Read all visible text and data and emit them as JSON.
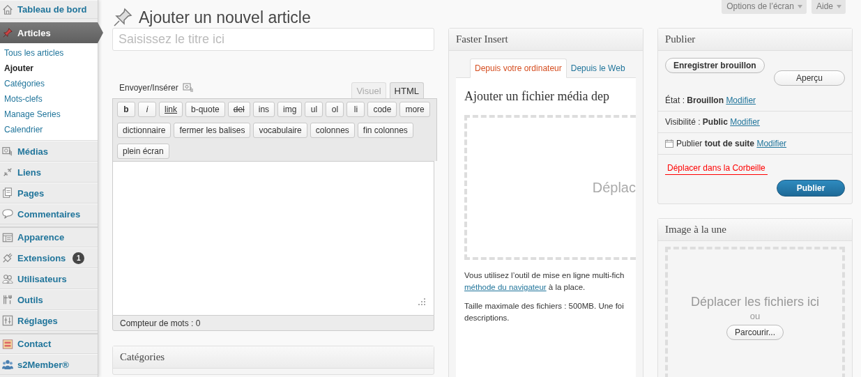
{
  "sidebar": {
    "items": [
      {
        "label": "Tableau de bord",
        "selected": false,
        "separator_before": false
      },
      {
        "label": "Articles",
        "selected": true,
        "separator_before": false,
        "children": [
          {
            "label": "Tous les articles",
            "selected": false
          },
          {
            "label": "Ajouter",
            "selected": true
          },
          {
            "label": "Catégories",
            "selected": false
          },
          {
            "label": "Mots-clefs",
            "selected": false
          },
          {
            "label": "Manage Series",
            "selected": false
          },
          {
            "label": "Calendrier",
            "selected": false
          }
        ]
      },
      {
        "label": "Médias",
        "selected": false,
        "separator_before": false
      },
      {
        "label": "Liens",
        "selected": false,
        "separator_before": false
      },
      {
        "label": "Pages",
        "selected": false,
        "separator_before": false
      },
      {
        "label": "Commentaires",
        "selected": false,
        "separator_before": false
      },
      {
        "label": "Apparence",
        "selected": false,
        "separator_before": true
      },
      {
        "label": "Extensions",
        "selected": false,
        "separator_before": false,
        "badge": "1"
      },
      {
        "label": "Utilisateurs",
        "selected": false,
        "separator_before": false
      },
      {
        "label": "Outils",
        "selected": false,
        "separator_before": false
      },
      {
        "label": "Réglages",
        "selected": false,
        "separator_before": false
      },
      {
        "label": "Contact",
        "selected": false,
        "separator_before": true
      },
      {
        "label": "s2Member®",
        "selected": false,
        "separator_before": false
      }
    ]
  },
  "header": {
    "title": "Ajouter un nouvel article",
    "screen_buttons": [
      "Options de l’écran",
      "Aide"
    ]
  },
  "post_title": {
    "placeholder": "Saisissez le titre ici"
  },
  "editor": {
    "upload_label": "Envoyer/Insérer",
    "tabs": [
      {
        "label": "Visuel",
        "selected": false
      },
      {
        "label": "HTML",
        "selected": true
      }
    ],
    "toolbar": [
      {
        "label": "b",
        "kind": "bold"
      },
      {
        "label": "i",
        "kind": "italic"
      },
      {
        "label": "link",
        "kind": "underline"
      },
      {
        "label": "b-quote",
        "kind": "plain"
      },
      {
        "label": "del",
        "kind": "strike"
      },
      {
        "label": "ins",
        "kind": "plain"
      },
      {
        "label": "img",
        "kind": "plain"
      },
      {
        "label": "ul",
        "kind": "plain"
      },
      {
        "label": "ol",
        "kind": "plain"
      },
      {
        "label": "li",
        "kind": "plain"
      },
      {
        "label": "code",
        "kind": "plain"
      },
      {
        "label": "more",
        "kind": "plain"
      },
      {
        "label": "dictionnaire",
        "kind": "plain"
      },
      {
        "label": "fermer les balises",
        "kind": "plain"
      },
      {
        "label": "vocabulaire",
        "kind": "plain"
      },
      {
        "label": "colonnes",
        "kind": "plain"
      },
      {
        "label": "fin colonnes",
        "kind": "plain"
      },
      {
        "label": "plein écran",
        "kind": "plain"
      }
    ],
    "word_count": "Compteur de mots : 0"
  },
  "categories_box": {
    "title": "Catégories"
  },
  "faster_insert": {
    "title": "Faster Insert",
    "tabs": [
      {
        "label": "Depuis votre ordinateur",
        "selected": true
      },
      {
        "label": "Depuis le Web",
        "selected": false
      }
    ],
    "heading": "Ajouter un fichier média dep",
    "drop_text": "Déplac",
    "notice": "Vous utilisez l’outil de mise en ligne multi-fich",
    "notice_link": "méthode du navigateur",
    "notice_after": "à la place.",
    "size_line": "Taille maximale des fichiers : 500MB. Une foi",
    "size_line_2": "descriptions."
  },
  "publish_box": {
    "title": "Publier",
    "save_draft": "Enregistrer brouillon",
    "preview": "Aperçu",
    "rows": [
      {
        "kind": "plain",
        "label": "État :",
        "value": "Brouillon",
        "link": "Modifier"
      },
      {
        "kind": "plain",
        "label": "Visibilité :",
        "value": "Public",
        "link": "Modifier"
      },
      {
        "kind": "schedule",
        "label": "Publier",
        "value": "tout de suite",
        "link": "Modifier"
      }
    ],
    "trash": "Déplacer dans la Corbeille",
    "publish": "Publier"
  },
  "featured_image": {
    "title": "Image à la une",
    "drop_text": "Déplacer les fichiers ici",
    "or": "ou",
    "browse": "Parcourir..."
  }
}
